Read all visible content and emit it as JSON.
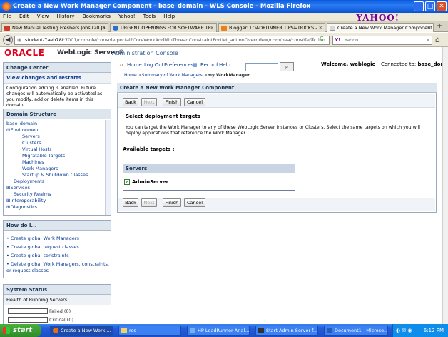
{
  "window": {
    "title": "Create a New Work Manager Component - base_domain - WLS Console - Mozilla Firefox"
  },
  "menu": [
    "File",
    "Edit",
    "View",
    "History",
    "Bookmarks",
    "Yahoo!",
    "Tools",
    "Help"
  ],
  "yahoo_brand": "YAHOO!",
  "tabs": [
    {
      "label": "New Manual Testing Freshers Jobs (20 Jo...",
      "color": "#cc3b2b"
    },
    {
      "label": "URGENT OPENINGS FOR SOFTWARE TE...",
      "color": "#2a6fd0"
    },
    {
      "label": "Blogger: LOADRUNNER TIPS&TRICKS - ...",
      "color": "#f07f12"
    },
    {
      "label": "Create a New Work Manager Component...",
      "color": "#d8d8d8"
    }
  ],
  "url": {
    "host": "student-7aeb78f",
    "rest": ":7001/console/console.portal?CoreWorkAddMinThreadConstraintPortlet_actionOverride=/com/bea/console/action"
  },
  "search_placeholder": "Yahoo",
  "brand": {
    "oracle": "ORACLE",
    "product": "WebLogic Server®",
    "console": "Administration Console"
  },
  "change_center": {
    "title": "Change Center",
    "link": "View changes and restarts",
    "text": "Configuration editing is enabled. Future changes will automatically be activated as you modify, add or delete items in this domain."
  },
  "domain_structure": {
    "title": "Domain Structure",
    "items": [
      "base_domain",
      "Environment",
      "Servers",
      "Clusters",
      "Virtual Hosts",
      "Migratable Targets",
      "Machines",
      "Work Managers",
      "Startup & Shutdown Classes",
      "Deployments",
      "Services",
      "Security Realms",
      "Interoperability",
      "Diagnostics"
    ]
  },
  "how_do_i": {
    "title": "How do I...",
    "items": [
      "Create global Work Managers",
      "Create global request classes",
      "Create global constraints",
      "Delete global Work Managers, constraints, or request classes"
    ]
  },
  "system_status": {
    "title": "System Status",
    "subtitle": "Health of Running Servers",
    "rows": [
      {
        "label": "Failed (0)"
      },
      {
        "label": "Critical (0)"
      }
    ]
  },
  "toolbar": {
    "home": "Home",
    "logout": "Log Out",
    "preferences": "Preferences",
    "record": "Record",
    "help": "Help"
  },
  "welcome": {
    "text": "Welcome, weblogic",
    "connected": "Connected to:",
    "domain": "base_domain"
  },
  "breadcrumb": {
    "home": "Home",
    "summary": "Summary of Work Managers",
    "current": "my WorkManager"
  },
  "main": {
    "title": "Create a New Work Manager Component",
    "buttons": {
      "back": "Back",
      "next": "Next",
      "finish": "Finish",
      "cancel": "Cancel"
    },
    "section": "Select deployment targets",
    "description": "You can target the Work Manager to any of these WebLogic Server instances or Clusters. Select the same targets on which you will deploy applications that reference the Work Manager.",
    "available": "Available targets :",
    "servers_header": "Servers",
    "server": "AdminServer"
  },
  "taskbar": {
    "start": "start",
    "tasks": [
      "Create a New Work ...",
      "res",
      "HP LoadRunner Anal...",
      "Start Admin Server f...",
      "Document1 - Microso..."
    ],
    "time": "6:12 PM"
  }
}
